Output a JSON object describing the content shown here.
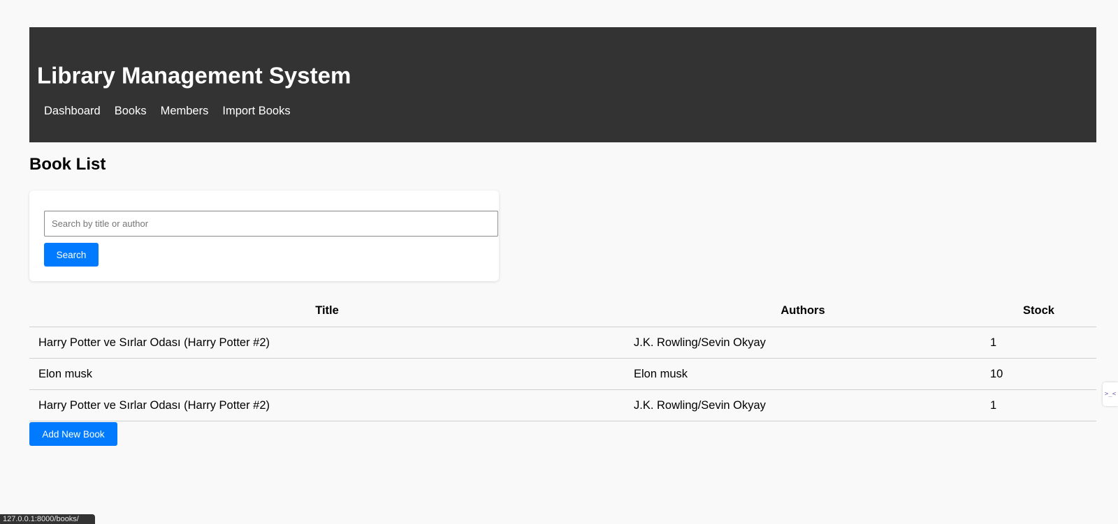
{
  "header": {
    "title": "Library Management System",
    "nav": [
      "Dashboard",
      "Books",
      "Members",
      "Import Books"
    ]
  },
  "page": {
    "title": "Book List"
  },
  "search": {
    "placeholder": "Search by title or author",
    "value": "",
    "button_label": "Search"
  },
  "table": {
    "columns": [
      "Title",
      "Authors",
      "Stock"
    ],
    "rows": [
      [
        "Harry Potter ve Sırlar Odası (Harry Potter #2)",
        "J.K. Rowling/Sevin Okyay",
        "1"
      ],
      [
        "Elon musk",
        "Elon musk",
        "10"
      ],
      [
        "Harry Potter ve Sırlar Odası (Harry Potter #2)",
        "J.K. Rowling/Sevin Okyay",
        "1"
      ]
    ]
  },
  "actions": {
    "add_label": "Add New Book"
  },
  "status_bar": {
    "url": "127.0.0.1:8000/books/"
  },
  "side_tab": {
    "icon": "terminal-prompt-icon",
    "glyph": ">_<"
  },
  "colors": {
    "header_bg": "#333333",
    "primary": "#007bff",
    "page_bg": "#f9f9f9"
  }
}
